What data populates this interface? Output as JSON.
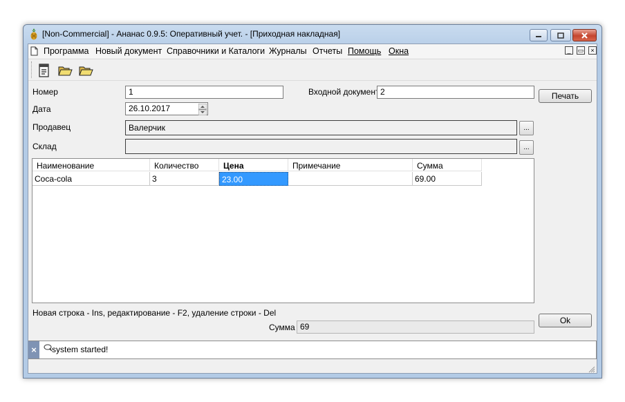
{
  "window": {
    "title": "[Non-Commercial] - Ананас 0.9.5: Оперативный учет. - [Приходная накладная]",
    "app_icon": "pineapple-icon",
    "controls": {
      "minimize": "minimize-icon",
      "maximize": "maximize-icon",
      "close": "close-icon"
    }
  },
  "menu": {
    "items": [
      "Программа",
      "Новый документ",
      "Справочники и Каталоги",
      "Журналы",
      "Отчеты",
      "Помощь",
      "Окна"
    ],
    "doc_icon": "document-icon",
    "mdi_controls": {
      "minimize": "_",
      "restore": "▭",
      "close": "×"
    }
  },
  "toolbar": {
    "buttons": [
      "notepad-icon",
      "folder-open-icon",
      "folder-open-icon"
    ]
  },
  "form": {
    "number_label": "Номер",
    "number_value": "1",
    "input_doc_label": "Входной документ",
    "input_doc_value": "2",
    "date_label": "Дата",
    "date_value": "26.10.2017",
    "seller_label": "Продавец",
    "seller_value": "Валерчик",
    "warehouse_label": "Склад",
    "warehouse_value": "",
    "browse_label": "...",
    "print_button": "Печать",
    "ok_button": "Ok"
  },
  "grid": {
    "columns": [
      "Наименование",
      "Количество",
      "Цена",
      "Примечание",
      "Сумма"
    ],
    "active_column": "Цена",
    "rows": [
      {
        "name": "Coca-cola",
        "qty": "3",
        "price": "23.00",
        "note": "",
        "sum": "69.00"
      }
    ]
  },
  "hint": "Новая строка - Ins,  редактирование - F2, удаление строки - Del",
  "total": {
    "label": "Сумма",
    "value": "69"
  },
  "log": {
    "close": "×",
    "icon": "speech-bubble-icon",
    "message": "system started!"
  },
  "colors": {
    "selection": "#3399ff",
    "title_gradient": "#c9dbef",
    "close_button": "#c4452f"
  }
}
